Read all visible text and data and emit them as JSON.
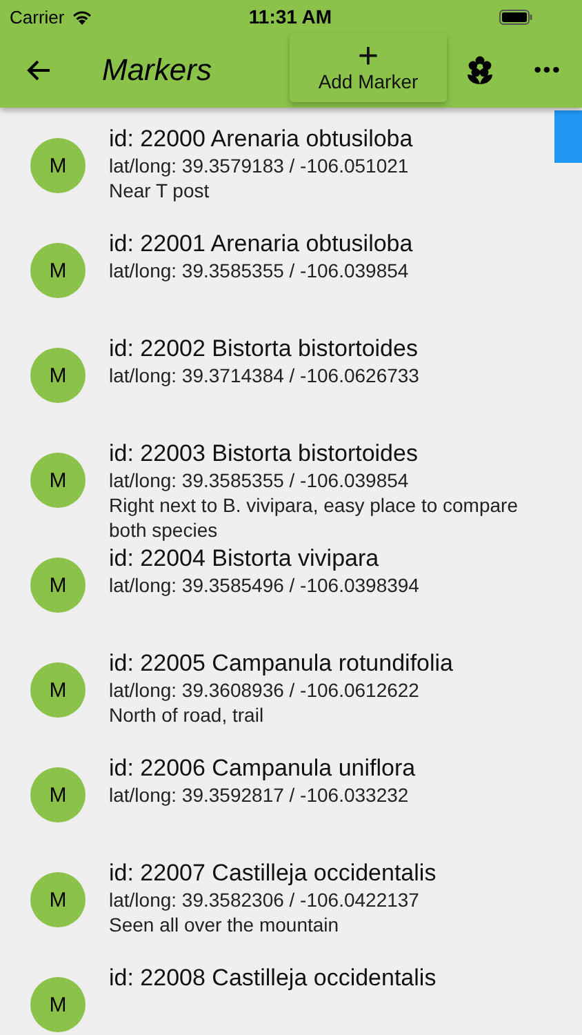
{
  "status_bar": {
    "carrier": "Carrier",
    "time": "11:31 AM"
  },
  "app_bar": {
    "title": "Markers",
    "add_button": {
      "icon": "+",
      "label": "Add Marker"
    },
    "more": "•••"
  },
  "markers": [
    {
      "avatar": "M",
      "title": "id: 22000 Arenaria obtusiloba",
      "coords": "lat/long:  39.3579183 / -106.051021",
      "note": "Near T post"
    },
    {
      "avatar": "M",
      "title": "id: 22001 Arenaria obtusiloba",
      "coords": "lat/long:  39.3585355 / -106.039854"
    },
    {
      "avatar": "M",
      "title": "id: 22002 Bistorta bistortoides",
      "coords": "lat/long:  39.3714384 / -106.0626733"
    },
    {
      "avatar": "M",
      "title": "id: 22003 Bistorta bistortoides",
      "coords": "lat/long:  39.3585355 / -106.039854",
      "note": "Right next to B. vivipara, easy place to compare both species"
    },
    {
      "avatar": "M",
      "title": "id: 22004 Bistorta vivipara",
      "coords": "lat/long:  39.3585496 / -106.0398394"
    },
    {
      "avatar": "M",
      "title": "id: 22005 Campanula rotundifolia",
      "coords": "lat/long:  39.3608936 / -106.0612622",
      "note": "North of road, trail"
    },
    {
      "avatar": "M",
      "title": "id: 22006 Campanula uniflora",
      "coords": "lat/long:  39.3592817 / -106.033232"
    },
    {
      "avatar": "M",
      "title": "id: 22007 Castilleja occidentalis",
      "coords": "lat/long:  39.3582306 / -106.0422137",
      "note": "Seen all over the mountain"
    },
    {
      "avatar": "M",
      "title": "id: 22008 Castilleja occidentalis"
    }
  ]
}
